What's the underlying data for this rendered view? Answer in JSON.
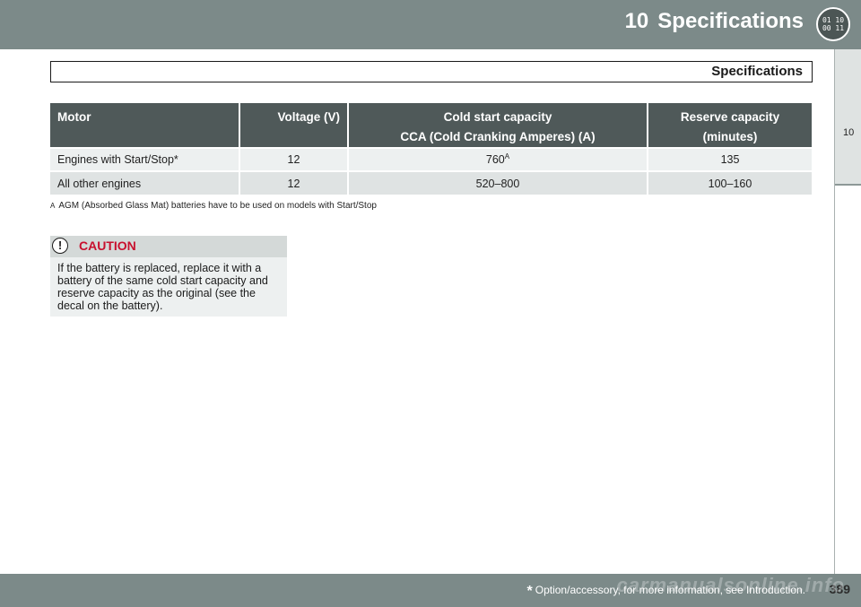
{
  "header": {
    "chapter_number": "10",
    "chapter_title": "Specifications",
    "icon_name": "specifications-chapter-icon"
  },
  "sidetab": {
    "label": "10"
  },
  "section": {
    "title": "Specifications"
  },
  "table": {
    "columns": [
      {
        "line1": "Motor",
        "line2": ""
      },
      {
        "line1": "Voltage (V)",
        "line2": ""
      },
      {
        "line1": "Cold start capacity",
        "line2": "CCA (Cold Cranking Amperes) (A)"
      },
      {
        "line1": "Reserve capacity",
        "line2": "(minutes)"
      }
    ],
    "rows": [
      {
        "motor": "Engines with Start/Stop*",
        "voltage": "12",
        "cca": "760",
        "cca_note": "A",
        "reserve": "135"
      },
      {
        "motor": "All other engines",
        "voltage": "12",
        "cca": "520–800",
        "cca_note": "",
        "reserve": "100–160"
      }
    ]
  },
  "footnote": {
    "mark": "A",
    "text": "AGM (Absorbed Glass Mat) batteries have to be used on models with Start/Stop"
  },
  "caution": {
    "title": "CAUTION",
    "icon": "!",
    "text": "If the battery is replaced, replace it with a battery of the same cold start capacity and reserve capacity as the original (see the decal on the battery)."
  },
  "footer": {
    "star": "*",
    "note": "Option/accessory, for more information, see Introduction.",
    "page_number": "389",
    "watermark": "carmanualsonline.info"
  }
}
